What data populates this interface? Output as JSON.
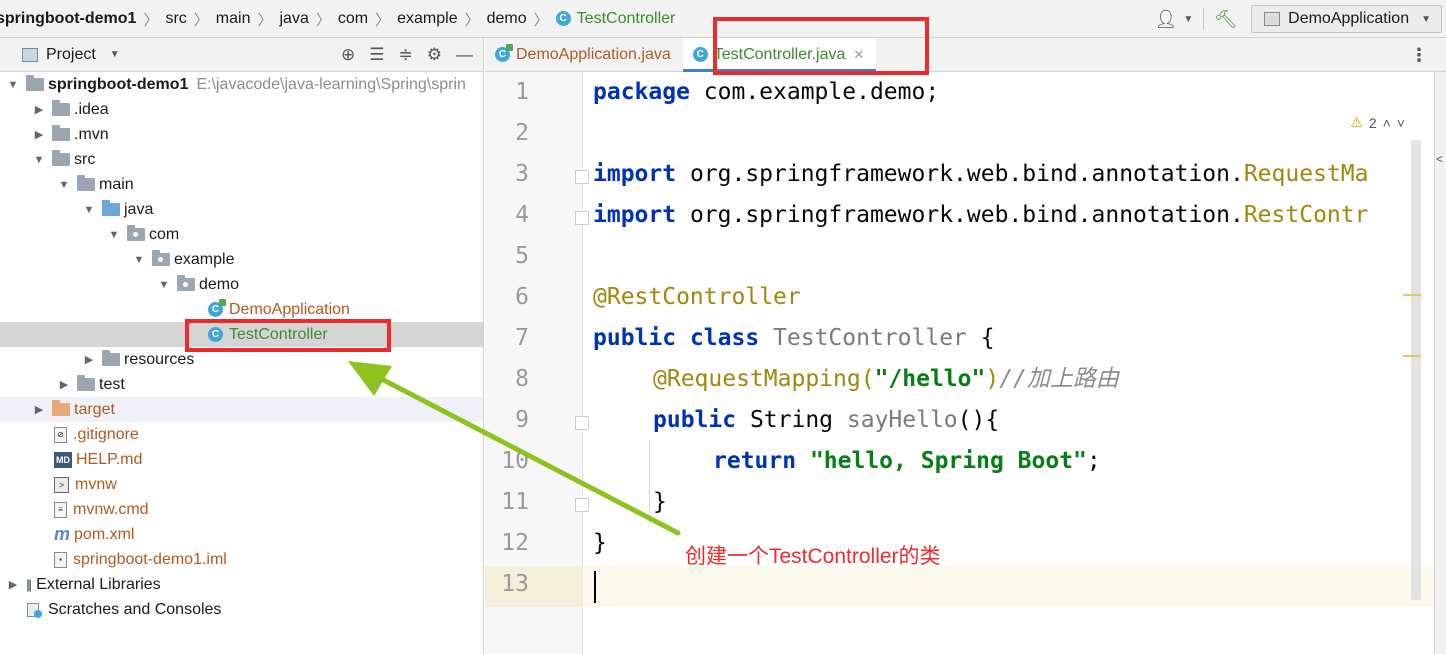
{
  "breadcrumb": {
    "items": [
      "springboot-demo1",
      "src",
      "main",
      "java",
      "com",
      "example",
      "demo"
    ],
    "current": "TestController"
  },
  "toolbar": {
    "run_config": "DemoApplication",
    "user_icon": "user-icon",
    "build_icon": "hammer-icon"
  },
  "project_panel": {
    "title": "Project",
    "root": {
      "name": "springboot-demo1",
      "path": "E:\\javacode\\java-learning\\Spring\\sprin"
    },
    "tree": [
      {
        "label": ".idea"
      },
      {
        "label": ".mvn"
      },
      {
        "label": "src"
      },
      {
        "label": "main"
      },
      {
        "label": "java"
      },
      {
        "label": "com"
      },
      {
        "label": "example"
      },
      {
        "label": "demo"
      },
      {
        "label": "DemoApplication"
      },
      {
        "label": "TestController"
      },
      {
        "label": "resources"
      },
      {
        "label": "test"
      },
      {
        "label": "target"
      },
      {
        "label": ".gitignore"
      },
      {
        "label": "HELP.md"
      },
      {
        "label": "mvnw"
      },
      {
        "label": "mvnw.cmd"
      },
      {
        "label": "pom.xml"
      },
      {
        "label": "springboot-demo1.iml"
      },
      {
        "label": "External Libraries"
      },
      {
        "label": "Scratches and Consoles"
      }
    ]
  },
  "editor": {
    "tabs": [
      {
        "label": "DemoApplication.java"
      },
      {
        "label": "TestController.java"
      }
    ],
    "warnings": "2",
    "line_numbers": [
      "1",
      "2",
      "3",
      "4",
      "5",
      "6",
      "7",
      "8",
      "9",
      "10",
      "11",
      "12",
      "13"
    ],
    "code": {
      "l1_kw": "package",
      "l1_rest": " com.example.demo;",
      "l3_kw": "import",
      "l3_pkg": " org.springframework.web.bind.annotation.",
      "l3_cls": "RequestMa",
      "l4_kw": "import",
      "l4_pkg": " org.springframework.web.bind.annotation.",
      "l4_cls": "RestContr",
      "l6_ann": "@RestController",
      "l7_kw1": "public",
      "l7_kw2": " class",
      "l7_name": " TestController",
      "l7_brace": " {",
      "l8_ann": "@RequestMapping(",
      "l8_str": "\"/hello\"",
      "l8_close": ")",
      "l8_cmt": "//加上路由",
      "l9_kw": "public",
      "l9_type": " String",
      "l9_method": " sayHello",
      "l9_rest": "(){",
      "l10_kw": "return",
      "l10_str": " \"hello, Spring Boot\"",
      "l10_end": ";",
      "l11": "}",
      "l12": "}"
    }
  },
  "annotation": {
    "caption": "创建一个TestController的类"
  }
}
